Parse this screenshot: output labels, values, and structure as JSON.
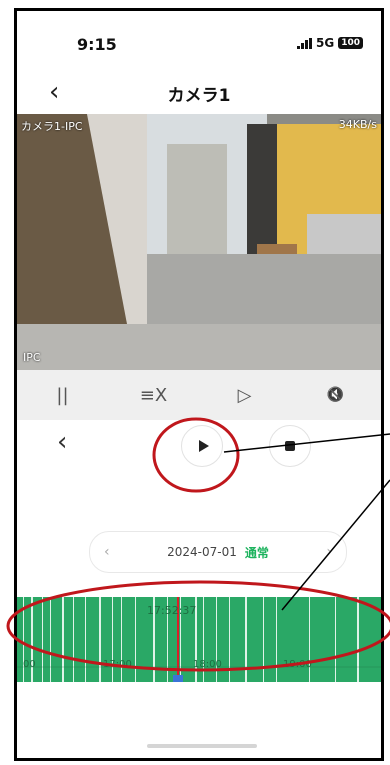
{
  "status_bar": {
    "time": "9:15",
    "network": "5G",
    "battery": "100"
  },
  "nav": {
    "title": "カメラ1"
  },
  "video": {
    "camera_name": "カメラ1-IPC",
    "bitrate": "34KB/s",
    "source": "IPC"
  },
  "controls": [
    {
      "icon": "pause-icon",
      "glyph": "||"
    },
    {
      "icon": "record-stop-icon",
      "glyph": "≡X"
    },
    {
      "icon": "play-next-icon",
      "glyph": "▷"
    },
    {
      "icon": "mute-icon",
      "glyph": "🔇"
    }
  ],
  "date_selector": {
    "date": "2024-07-01",
    "mode": "通常"
  },
  "timeline": {
    "current_time": "17:52:37",
    "ticks": [
      "00",
      "17:00",
      "18:00",
      "19:00"
    ]
  },
  "colors": {
    "timeline_green": "#2aa866",
    "accent_green": "#1db35e",
    "annotation_red": "#c0171c"
  }
}
